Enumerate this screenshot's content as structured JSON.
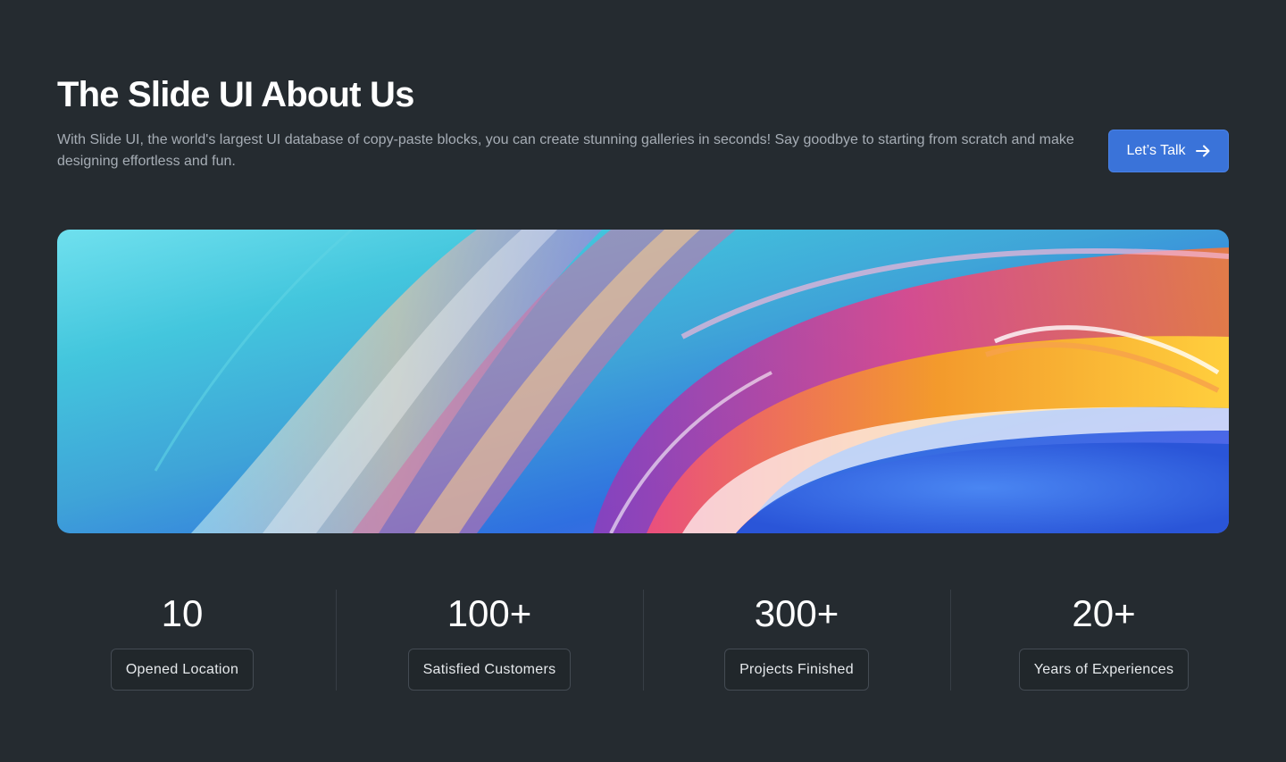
{
  "header": {
    "title": "The Slide UI About Us",
    "description": "With Slide UI, the world's largest UI database of copy-paste blocks, you can create stunning galleries in seconds! Say goodbye to starting from scratch and make designing effortless and fun.",
    "cta_label": "Let’s Talk",
    "cta_icon": "arrow-right-icon"
  },
  "hero_image": {
    "subject": "abstract colorful glass swirl"
  },
  "stats": [
    {
      "value": "10",
      "label": "Opened Location"
    },
    {
      "value": "100+",
      "label": "Satisfied Customers"
    },
    {
      "value": "300+",
      "label": "Projects Finished"
    },
    {
      "value": "20+",
      "label": "Years of Experiences"
    }
  ],
  "colors": {
    "background": "#252b30",
    "accent": "#3a73d9",
    "muted_text": "#a6adb5"
  }
}
